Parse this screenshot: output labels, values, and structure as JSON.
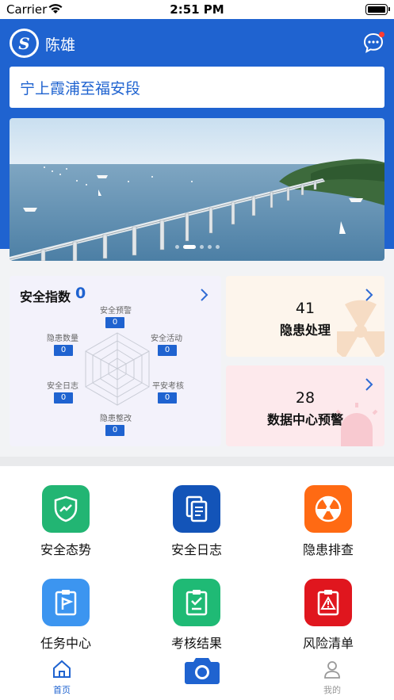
{
  "status_bar": {
    "carrier": "Carrier",
    "time": "2:51 PM"
  },
  "header": {
    "username": "陈雄",
    "logo_letter": "S"
  },
  "route": {
    "name": "宁上霞浦至福安段"
  },
  "banner": {
    "slides": 5,
    "active_slide": 2
  },
  "safety": {
    "title": "安全指数",
    "score": "0",
    "metrics": [
      {
        "label": "安全预警",
        "value": "0"
      },
      {
        "label": "安全活动",
        "value": "0"
      },
      {
        "label": "平安考核",
        "value": "0"
      },
      {
        "label": "隐患整改",
        "value": "0"
      },
      {
        "label": "安全日志",
        "value": "0"
      },
      {
        "label": "隐患数量",
        "value": "0"
      }
    ]
  },
  "hazard_card": {
    "count": "41",
    "label": "隐患处理"
  },
  "data_center_card": {
    "count": "28",
    "label": "数据中心预警"
  },
  "grid": [
    {
      "label": "安全态势",
      "icon": "shield-chart-icon",
      "color": "#22b573"
    },
    {
      "label": "安全日志",
      "icon": "document-icon",
      "color": "#1354b8"
    },
    {
      "label": "隐患排查",
      "icon": "radiation-icon",
      "color": "#ff6a13"
    },
    {
      "label": "任务中心",
      "icon": "clipboard-flag-icon",
      "color": "#3c95f0"
    },
    {
      "label": "考核结果",
      "icon": "clipboard-check-icon",
      "color": "#1fba75"
    },
    {
      "label": "风险清单",
      "icon": "clipboard-warning-icon",
      "color": "#e0161e"
    }
  ],
  "tabbar": {
    "home": "首页",
    "mine": "我的",
    "active_color": "#1f63d0"
  }
}
